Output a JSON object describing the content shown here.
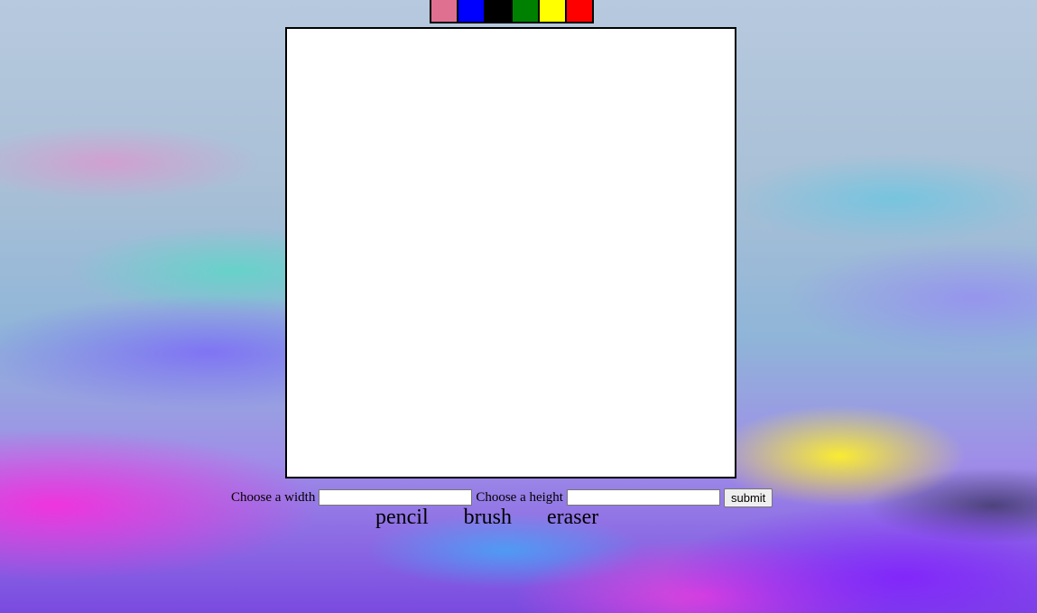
{
  "palette": {
    "swatches": [
      {
        "name": "pink",
        "color": "#e07090"
      },
      {
        "name": "blue",
        "color": "#0000ff"
      },
      {
        "name": "black",
        "color": "#000000"
      },
      {
        "name": "green",
        "color": "#008000"
      },
      {
        "name": "yellow",
        "color": "#ffff00"
      },
      {
        "name": "red",
        "color": "#ff0000"
      }
    ]
  },
  "canvas": {
    "background_color": "#ffffff"
  },
  "size_form": {
    "width_label": "Choose a width",
    "width_value": "",
    "height_label": "Choose a height",
    "height_value": "",
    "submit_label": "submit"
  },
  "tools": {
    "pencil_label": "pencil",
    "brush_label": "brush",
    "eraser_label": "eraser"
  }
}
